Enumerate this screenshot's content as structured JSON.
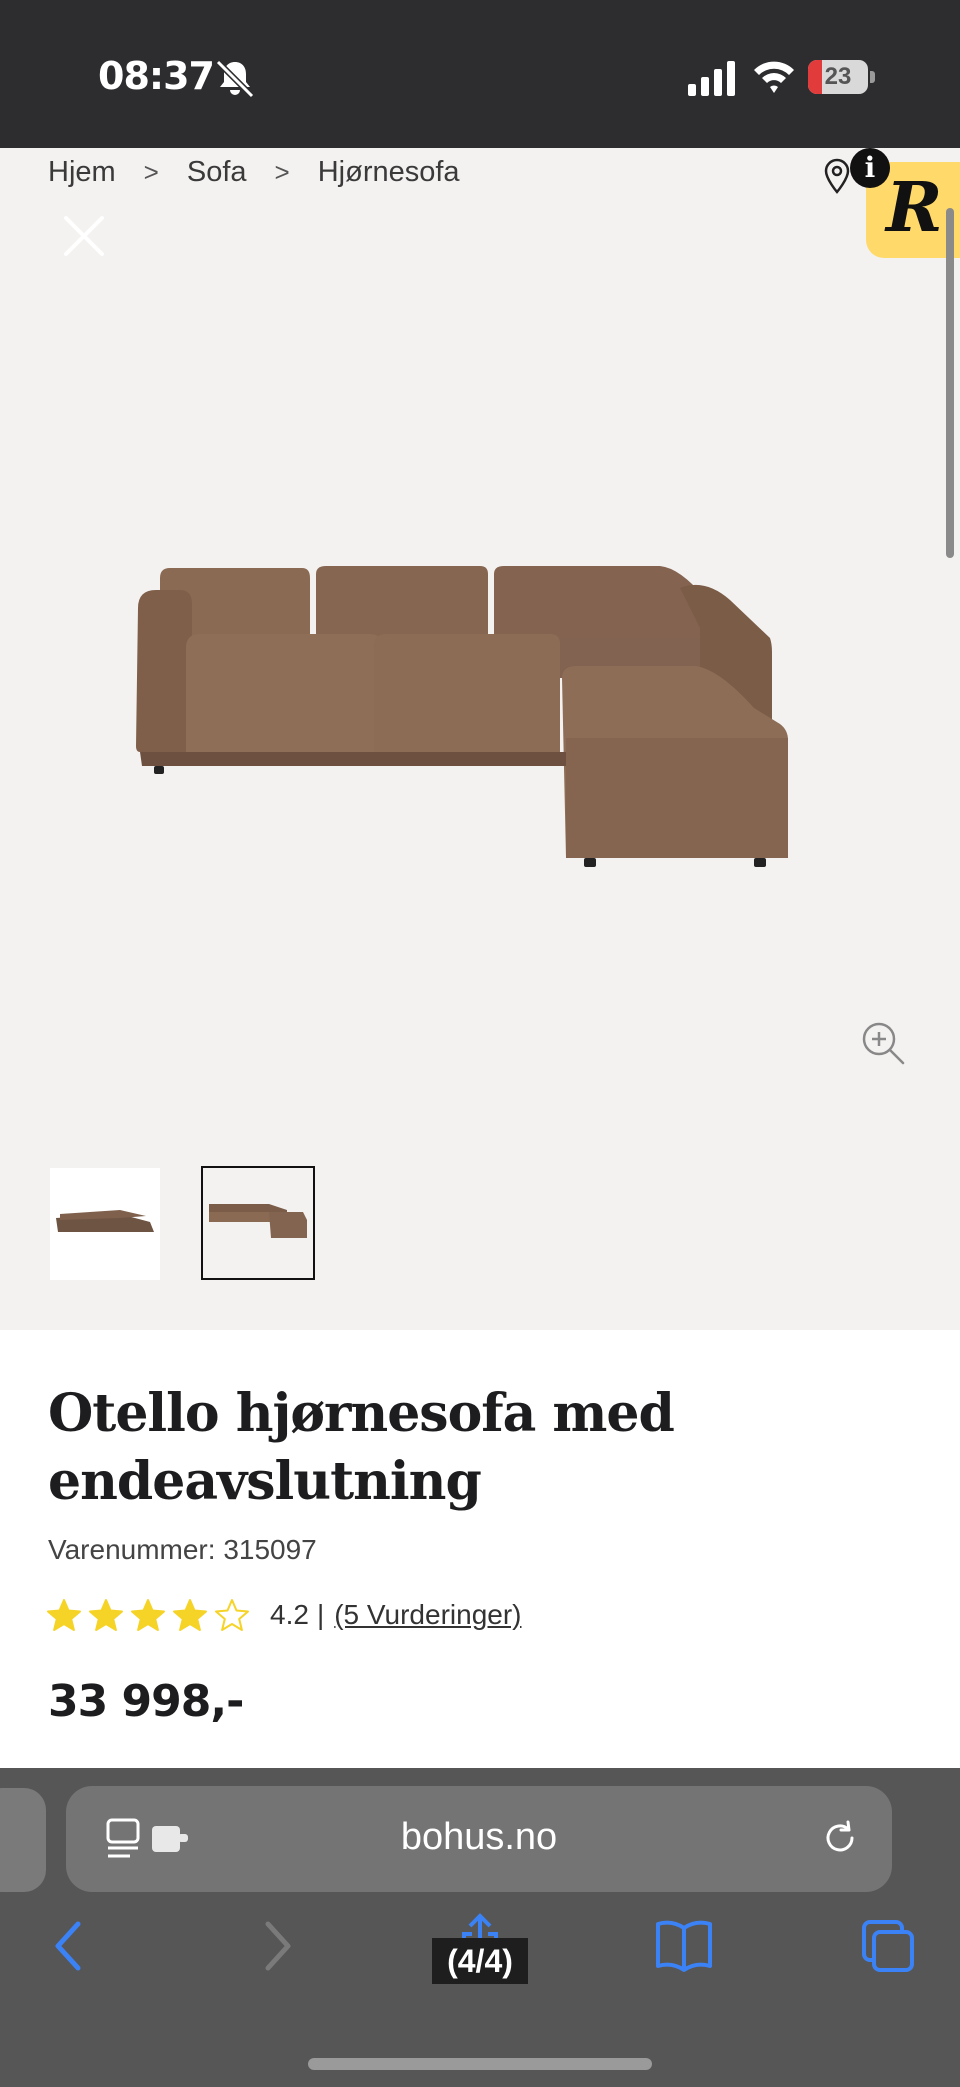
{
  "status_bar": {
    "time": "08:37",
    "battery_level": "23",
    "battery_fraction": 0.23
  },
  "breadcrumb": {
    "items": [
      "Hjem",
      "Sofa",
      "Hjørnesofa"
    ],
    "separator": ">"
  },
  "badge": {
    "letter": "R",
    "info": "i",
    "color": "#ffd96a"
  },
  "gallery": {
    "background": "#f4f2f1",
    "sofa_color": "#8a6a52",
    "thumbnail_count": 2,
    "selected_thumbnail": 2
  },
  "product": {
    "title": "Otello hjørnesofa med endeavslutning",
    "sku": "Varenummer: 315097",
    "rating_value": "4.2",
    "rating_stars": 4,
    "rating_max": 5,
    "rating_separator": "|",
    "reviews_text": "(5 Vurderinger)",
    "price": "33 998,-",
    "star_color": "#f5d327"
  },
  "browser": {
    "url": "bohus.no",
    "page_counter": "(4/4)",
    "accent_color": "#3b82f6"
  },
  "icons": [
    "bell-slash-icon",
    "signal-icon",
    "wifi-icon",
    "battery-icon",
    "close-icon",
    "location-icon",
    "info-icon",
    "zoom-in-icon",
    "star-icon",
    "reader-icon",
    "extension-icon",
    "reload-icon",
    "back-icon",
    "forward-icon",
    "share-icon",
    "bookmarks-icon",
    "tabs-icon"
  ]
}
